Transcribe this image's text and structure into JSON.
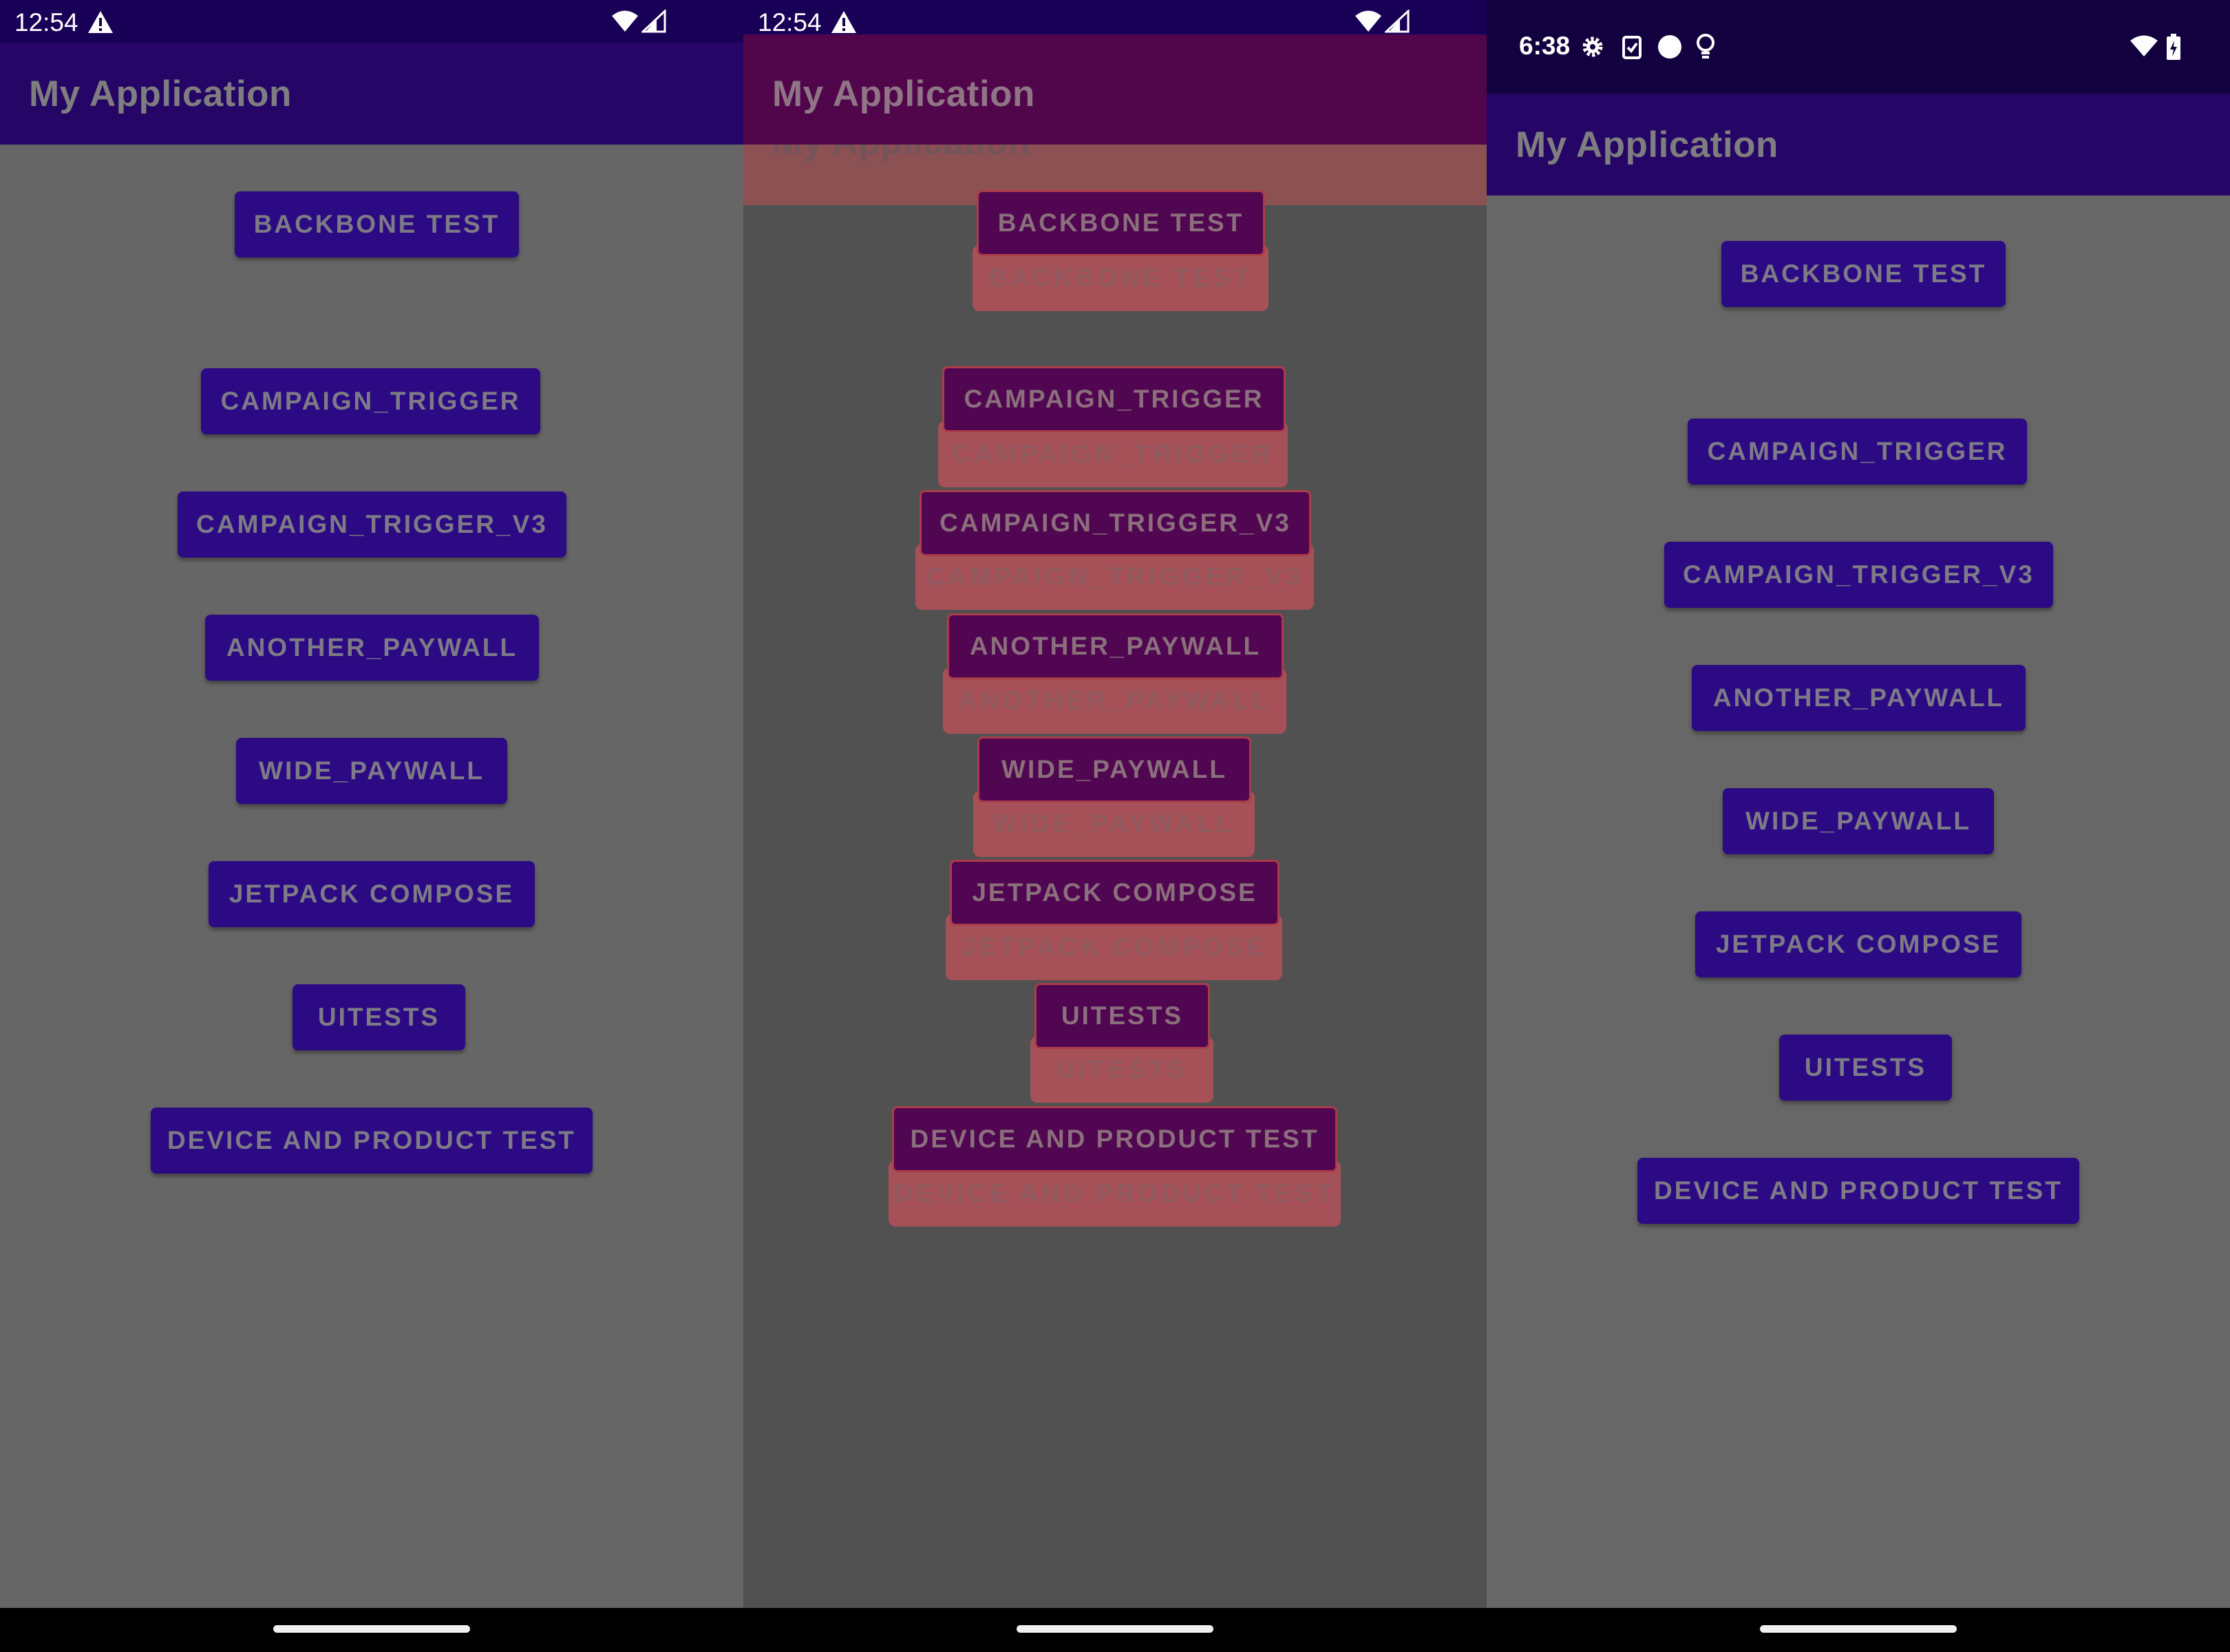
{
  "panel1": {
    "status_time": "12:54",
    "app_title": "My Application",
    "buttons": [
      "BACKBONE TEST",
      "CAMPAIGN_TRIGGER",
      "CAMPAIGN_TRIGGER_V3",
      "ANOTHER_PAYWALL",
      "WIDE_PAYWALL",
      "JETPACK COMPOSE",
      "UITESTS",
      "DEVICE AND PRODUCT TEST"
    ]
  },
  "panel2": {
    "status_time": "12:54",
    "app_title": "My Application",
    "ghost_title": "My Application",
    "buttons": [
      "BACKBONE TEST",
      "CAMPAIGN_TRIGGER",
      "CAMPAIGN_TRIGGER_V3",
      "ANOTHER_PAYWALL",
      "WIDE_PAYWALL",
      "JETPACK COMPOSE",
      "UITESTS",
      "DEVICE AND PRODUCT TEST"
    ],
    "ghost_buttons": [
      "BACKBONE TEST",
      "CAMPAIGN_TRIGGER",
      "CAMPAIGN_TRIGGER_V3",
      "ANOTHER_PAYWALL",
      "WIDE_PAYWALL",
      "JETPACK COMPOSE",
      "UITESTS",
      "DEVICE AND PRODUCT TEST"
    ]
  },
  "panel3": {
    "status_time": "6:38",
    "app_title": "My Application",
    "buttons": [
      "BACKBONE TEST",
      "CAMPAIGN_TRIGGER",
      "CAMPAIGN_TRIGGER_V3",
      "ANOTHER_PAYWALL",
      "WIDE_PAYWALL",
      "JETPACK COMPOSE",
      "UITESTS",
      "DEVICE AND PRODUCT TEST"
    ]
  },
  "icons": {
    "warning": "warning-icon",
    "wifi": "wifi-icon",
    "signal": "signal-icon",
    "gear": "gear-icon",
    "clipboard": "clipboard-icon",
    "circle": "circle-icon",
    "bulb": "bulb-icon",
    "battery": "battery-icon"
  },
  "colors": {
    "statusbar_p1": "#180057",
    "appbar_p1": "#250565",
    "statusbar_p2": "#180057",
    "appbar_p2": "#51064c",
    "ghost": "#a55157",
    "button": "#2c0a84",
    "background": "#666666"
  }
}
